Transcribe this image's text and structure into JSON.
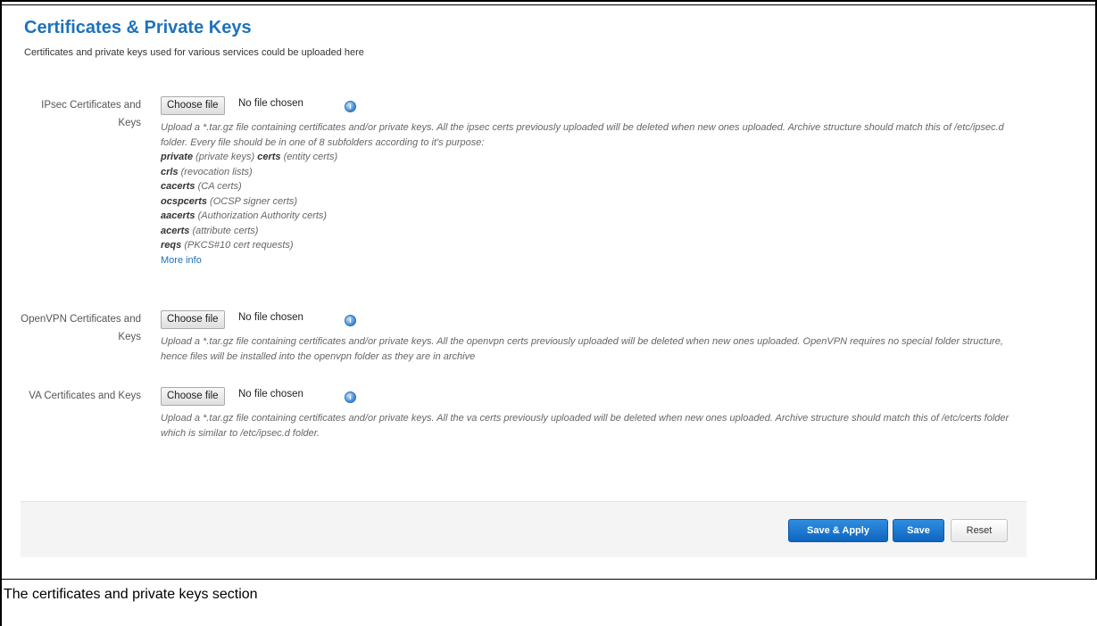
{
  "header": {
    "title": "Certificates & Private Keys",
    "subtitle": "Certificates and private keys used for various services could be uploaded here"
  },
  "file_input": {
    "button_label": "Choose file",
    "status": "No file chosen"
  },
  "ipsec": {
    "label": "IPsec Certificates and Keys",
    "description": "Upload a *.tar.gz file containing certificates and/or private keys. All the ipsec certs previously uploaded will be deleted when new ones uploaded. Archive structure should match this of /etc/ipsec.d folder. Every file should be in one of 8 subfolders according to it's purpose:",
    "folders": [
      {
        "name": "private",
        "desc": "(private keys)",
        "name2": "certs",
        "desc2": "(entity certs)"
      },
      {
        "name": "crls",
        "desc": "(revocation lists)"
      },
      {
        "name": "cacerts",
        "desc": "(CA certs)"
      },
      {
        "name": "ocspcerts",
        "desc": "(OCSP signer certs)"
      },
      {
        "name": "aacerts",
        "desc": "(Authorization Authority certs)"
      },
      {
        "name": "acerts",
        "desc": "(attribute certs)"
      },
      {
        "name": "reqs",
        "desc": "(PKCS#10 cert requests)"
      }
    ],
    "more_info": "More info"
  },
  "openvpn": {
    "label": "OpenVPN Certificates and Keys",
    "description": "Upload a *.tar.gz file containing certificates and/or private keys. All the openvpn certs previously uploaded will be deleted when new ones uploaded. OpenVPN requires no special folder structure, hence files will be installed into the openvpn folder as they are in archive"
  },
  "va": {
    "label": "VA Certificates and Keys",
    "description": "Upload a *.tar.gz file containing certificates and/or private keys. All the va certs previously uploaded will be deleted when new ones uploaded. Archive structure should match this of /etc/certs folder which is similar to /etc/ipsec.d folder."
  },
  "footer": {
    "save_apply": "Save & Apply",
    "save": "Save",
    "reset": "Reset"
  },
  "icons": {
    "help": "help-icon"
  },
  "colors": {
    "accent": "#1e72bb",
    "button_primary": "#1a77d0"
  },
  "caption": "The certificates and private keys section"
}
